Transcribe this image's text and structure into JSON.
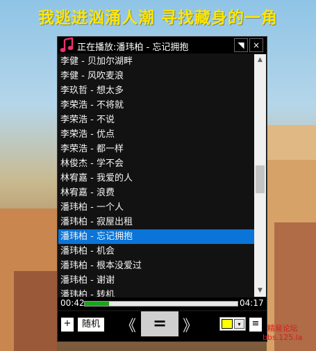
{
  "lyric": "我逃进汹涌人潮 寻找藏身的一角",
  "window": {
    "title": "正在播放:潘玮柏 - 忘记拥抱",
    "menu_glyph": "◥",
    "close_glyph": "×"
  },
  "playlist": [
    "李健 - 贝加尔湖畔",
    "李健 - 风吹麦浪",
    "李玖哲 - 想太多",
    "李荣浩 - 不将就",
    "李荣浩 - 不说",
    "李荣浩 - 优点",
    "李荣浩 - 都一样",
    "林俊杰 - 学不会",
    "林宥嘉 - 我爱的人",
    "林宥嘉 - 浪费",
    "潘玮柏 - 一个人",
    "潘玮柏 - 寂屋出租",
    "潘玮柏 - 忘记拥抱",
    "潘玮柏 - 机会",
    "潘玮柏 - 根本没爱过",
    "潘玮柏 - 谢谢",
    "潘玮柏 - 转机"
  ],
  "selected_index": 12,
  "scroll_up_glyph": "▲",
  "scroll_down_glyph": "▼",
  "progress": {
    "elapsed": "00:42",
    "total": "04:17",
    "fraction": 0.16
  },
  "controls": {
    "add": "+",
    "random": "随机",
    "prev": "《",
    "play": "=",
    "next": "》",
    "menu": "≡",
    "dropdown_glyph": "▾"
  },
  "colors": {
    "accent": "#0a74d8",
    "lyric": "#ffe600",
    "progress_fill": "#1aa51a",
    "swatch": "#ffff00",
    "note_icon": "#e8336d"
  },
  "watermark": {
    "line1": "精易论坛",
    "line2": "bbs.125.la"
  }
}
